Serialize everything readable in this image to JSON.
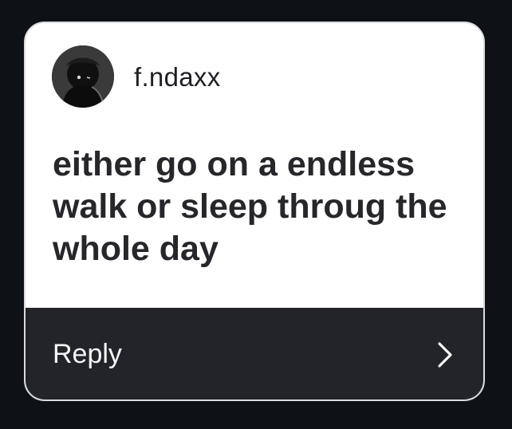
{
  "post": {
    "username": "f.ndaxx",
    "avatar_icon": "profile-avatar",
    "message": "either go on a endless walk or sleep throug the whole day"
  },
  "reply": {
    "label": "Reply",
    "icon": "chevron-right-icon"
  },
  "colors": {
    "page_background": "#0e1116",
    "card_background": "#ffffff",
    "reply_background": "#222429",
    "text_dark": "#26262b",
    "text_light": "#f5f6f7"
  }
}
